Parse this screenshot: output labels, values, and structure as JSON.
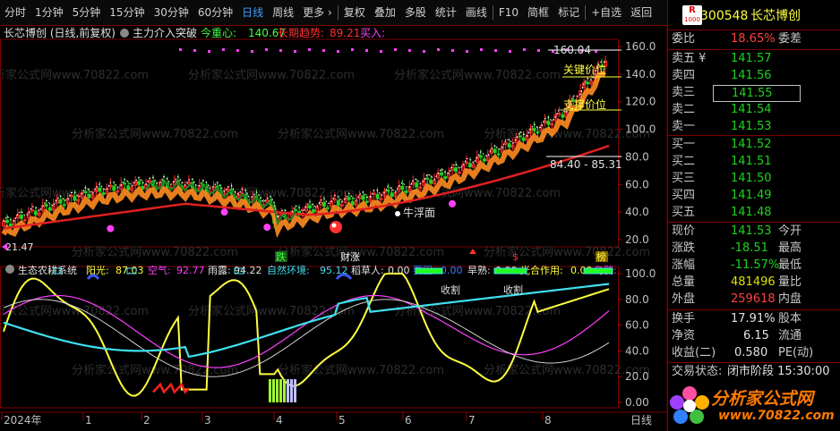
{
  "toolbar": [
    {
      "label": "分时",
      "active": false
    },
    {
      "label": "1分钟",
      "active": false
    },
    {
      "label": "5分钟",
      "active": false
    },
    {
      "label": "15分钟",
      "active": false
    },
    {
      "label": "30分钟",
      "active": false
    },
    {
      "label": "60分钟",
      "active": false
    },
    {
      "label": "日线",
      "active": true
    },
    {
      "label": "周线",
      "active": false
    },
    {
      "label": "更多 ›",
      "active": false
    },
    {
      "label": "复权",
      "active": false
    },
    {
      "label": "叠加",
      "active": false
    },
    {
      "label": "多股",
      "active": false
    },
    {
      "label": "统计",
      "active": false
    },
    {
      "label": "画线",
      "active": false
    },
    {
      "label": "F10",
      "active": false
    },
    {
      "label": "简框",
      "active": false
    },
    {
      "label": "标记",
      "active": false
    },
    {
      "label": "+自选",
      "active": false
    },
    {
      "label": "返回",
      "active": false
    }
  ],
  "main_info": {
    "stock_label": "长芯博创 (日线,前复权)",
    "indicator_name": "主力介入突破",
    "today_center_label": "今重心:",
    "today_center_value": "140.67",
    "long_trend_label": "长期趋势:",
    "long_trend_value": "89.21",
    "buy_label": "买入:"
  },
  "main_annotations": {
    "high_price": "160.04",
    "key_price": "关键价位",
    "support_price": "支撑价位",
    "low_range": "84.40 - 85.31",
    "float_label": "牛浮面",
    "low_left": "21.47",
    "fall_label": "跌",
    "fortune_label": "财涨",
    "tag_s": "$",
    "tag_rank": "榜"
  },
  "main_axis": [
    "160.0",
    "140.0",
    "120.0",
    "100.0",
    "80.0",
    "60.0",
    "40.0",
    "20.0"
  ],
  "sub_info": {
    "name": "生态农耕系统",
    "sun_label": "阳光:",
    "sun_value": "87.03",
    "air_label": "空气:",
    "air_value": "92.77",
    "rain_label": "雨露:",
    "rain_value": "94.22",
    "env_label": "自然环境:",
    "env_value": "95.12",
    "scare_label": "稻草人:",
    "scare_value": "0.00",
    "cause_label": "要因:",
    "cause_value": "0.00",
    "drought_label": "旱熟:",
    "drought_value": "0.00",
    "photo_label": "光合作用:",
    "photo_value": "0.00",
    "crow_label": "乌鸦:",
    "harvest1": "收割",
    "harvest2": "收割"
  },
  "sub_axis": [
    "100.0",
    "80.0",
    "60.0",
    "40.0",
    "20.0",
    "0.00"
  ],
  "date_axis": [
    "2024年",
    "1",
    "2",
    "3",
    "4",
    "5",
    "6",
    "7",
    "8"
  ],
  "date_corner": "日线",
  "watermark": "分析家公式网www.70822.com",
  "logo": {
    "title": "分析家公式网",
    "url": "www.70822.com"
  },
  "quote": {
    "code": "300548",
    "name": "长芯博创",
    "badge_top": "R",
    "badge_bottom": "1000",
    "commission_ratio_label": "委比",
    "commission_ratio": "18.65%",
    "commission_diff_label": "委差",
    "sells": [
      {
        "label": "卖五 ¥",
        "price": "141.57"
      },
      {
        "label": "卖四",
        "price": "141.56"
      },
      {
        "label": "卖三",
        "price": "141.55"
      },
      {
        "label": "卖二",
        "price": "141.54"
      },
      {
        "label": "卖一",
        "price": "141.53"
      }
    ],
    "buys": [
      {
        "label": "买一",
        "price": "141.52"
      },
      {
        "label": "买二",
        "price": "141.51"
      },
      {
        "label": "买三",
        "price": "141.50"
      },
      {
        "label": "买四",
        "price": "141.49"
      },
      {
        "label": "买五",
        "price": "141.48"
      }
    ],
    "now_label": "现价",
    "now": "141.53",
    "open_label": "今开",
    "change_label": "涨跌",
    "change": "-18.51",
    "high_label": "最高",
    "pct_label": "涨幅",
    "pct": "-11.57%",
    "low_label": "最低",
    "total_label": "总量",
    "total": "481496",
    "ratio_label": "量比",
    "outer_label": "外盘",
    "outer": "259618",
    "inner_label": "内盘",
    "turnover_label": "换手",
    "turnover": "17.91%",
    "equity_label": "股本",
    "net_label": "净资",
    "net": "6.15",
    "float_label": "流通",
    "income_label": "收益(二)",
    "income": "0.580",
    "pe_label": "PE(动)",
    "status_label": "交易状态:",
    "status_value": "闭市阶段 15:30:00"
  },
  "colors": {
    "up": "#ff3030",
    "down": "#20d020",
    "yellow": "#ffff40",
    "cyan": "#40e0f0",
    "magenta": "#ff40ff",
    "orange": "#ff8c20",
    "grid": "#7a0000"
  }
}
